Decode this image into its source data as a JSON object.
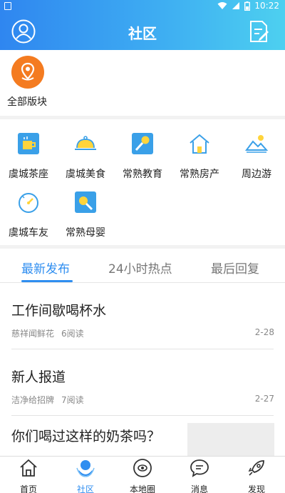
{
  "status_bar": {
    "time": "10:22"
  },
  "header": {
    "title": "社区"
  },
  "all_boards": {
    "label": "全部版块"
  },
  "forums": [
    {
      "label": "虞城茶座",
      "icon": "tea-cup-icon"
    },
    {
      "label": "虞城美食",
      "icon": "food-cloche-icon"
    },
    {
      "label": "常熟教育",
      "icon": "microphone-icon"
    },
    {
      "label": "常熟房产",
      "icon": "house-icon"
    },
    {
      "label": "周边游",
      "icon": "landscape-icon"
    },
    {
      "label": "虞城车友",
      "icon": "speedometer-icon"
    },
    {
      "label": "常熟母婴",
      "icon": "baby-bottle-icon"
    }
  ],
  "tabs": [
    {
      "label": "最新发布",
      "active": true
    },
    {
      "label": "24小时热点",
      "active": false
    },
    {
      "label": "最后回复",
      "active": false
    }
  ],
  "posts": [
    {
      "title": "工作间歇喝杯水",
      "author": "慈祥闻鲜花",
      "reads": "6阅读",
      "date": "2-28"
    },
    {
      "title": "新人报道",
      "author": "洁净给招牌",
      "reads": "7阅读",
      "date": "2-27"
    },
    {
      "title": "你们喝过这样的奶茶吗？",
      "author": "",
      "reads": "",
      "date": ""
    }
  ],
  "bottom_nav": [
    {
      "label": "首页",
      "icon": "home-icon",
      "active": false
    },
    {
      "label": "社区",
      "icon": "community-icon",
      "active": true
    },
    {
      "label": "本地圈",
      "icon": "local-circle-icon",
      "active": false
    },
    {
      "label": "消息",
      "icon": "message-icon",
      "active": false
    },
    {
      "label": "发现",
      "icon": "rocket-icon",
      "active": false
    }
  ],
  "colors": {
    "accent": "#2f8ef0",
    "header_start": "#2f86f0",
    "header_end": "#4dd0f0",
    "pin_orange": "#f47b20"
  }
}
